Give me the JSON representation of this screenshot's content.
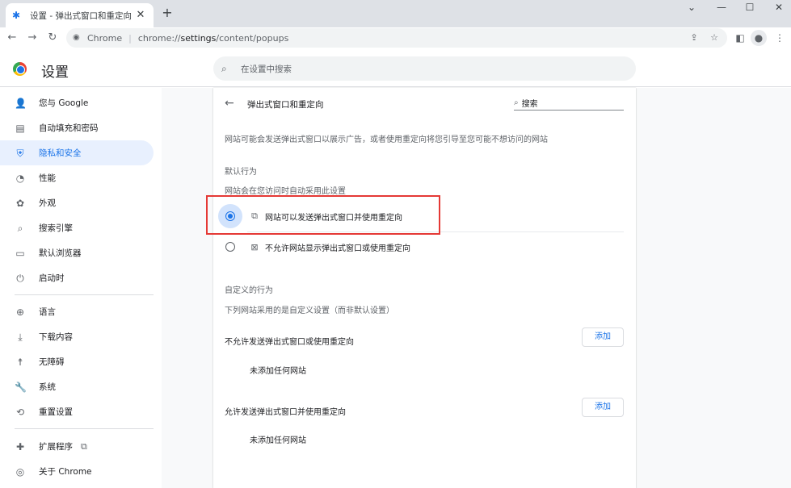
{
  "browser": {
    "tab_title": "设置 - 弹出式窗口和重定向",
    "tab_close": "✕",
    "new_tab": "+",
    "window_controls": [
      "⌄",
      "—",
      "☐",
      "✕"
    ],
    "site_name": "Chrome",
    "url_scheme": "chrome://",
    "url_host": "settings",
    "url_path": "/content/popups"
  },
  "header": {
    "title": "设置",
    "search_placeholder": "在设置中搜索"
  },
  "sidebar": {
    "items": [
      {
        "label": "您与 Google",
        "icon": "person-icon",
        "glyph": "👤",
        "active": false
      },
      {
        "label": "自动填充和密码",
        "icon": "clipboard-icon",
        "glyph": "📋",
        "active": false
      },
      {
        "label": "隐私和安全",
        "icon": "shield-icon",
        "glyph": "🛡",
        "active": true
      },
      {
        "label": "性能",
        "icon": "speedometer-icon",
        "glyph": "◔",
        "active": false
      },
      {
        "label": "外观",
        "icon": "palette-icon",
        "glyph": "🎨",
        "active": false
      },
      {
        "label": "搜索引擎",
        "icon": "search-icon",
        "glyph": "🔍",
        "active": false
      },
      {
        "label": "默认浏览器",
        "icon": "browser-icon",
        "glyph": "▭",
        "active": false
      },
      {
        "label": "启动时",
        "icon": "power-icon",
        "glyph": "⏻",
        "active": false
      },
      {
        "label": "语言",
        "icon": "globe-icon",
        "glyph": "🌐",
        "active": false
      },
      {
        "label": "下载内容",
        "icon": "download-icon",
        "glyph": "⬇",
        "active": false
      },
      {
        "label": "无障碍",
        "icon": "accessibility-icon",
        "glyph": "♿",
        "active": false
      },
      {
        "label": "系统",
        "icon": "wrench-icon",
        "glyph": "🔧",
        "active": false
      },
      {
        "label": "重置设置",
        "icon": "reset-icon",
        "glyph": "⟲",
        "active": false
      },
      {
        "label": "扩展程序",
        "icon": "puzzle-icon",
        "glyph": "🧩",
        "active": false
      },
      {
        "label": "关于 Chrome",
        "icon": "chrome-icon",
        "glyph": "◎",
        "active": false
      }
    ]
  },
  "page": {
    "heading": "弹出式窗口和重定向",
    "search_placeholder": "搜索",
    "description": "网站可能会发送弹出式窗口以展示广告，或者使用重定向将您引导至您可能不想访问的网站",
    "default_behavior": {
      "title": "默认行为",
      "subtitle": "网站会在您访问时自动采用此设置",
      "options": [
        {
          "label": "网站可以发送弹出式窗口并使用重定向",
          "selected": true
        },
        {
          "label": "不允许网站显示弹出式窗口或使用重定向",
          "selected": false
        }
      ]
    },
    "custom_behavior": {
      "title": "自定义的行为",
      "subtitle": "下列网站采用的是自定义设置（而非默认设置）",
      "sections": [
        {
          "title": "不允许发送弹出式窗口或使用重定向",
          "add_label": "添加",
          "empty": "未添加任何网站"
        },
        {
          "title": "允许发送弹出式窗口并使用重定向",
          "add_label": "添加",
          "empty": "未添加任何网站"
        }
      ]
    }
  },
  "colors": {
    "accent": "#1a73e8",
    "active_bg": "#e8f0fe",
    "highlight_box": "#e53935"
  }
}
